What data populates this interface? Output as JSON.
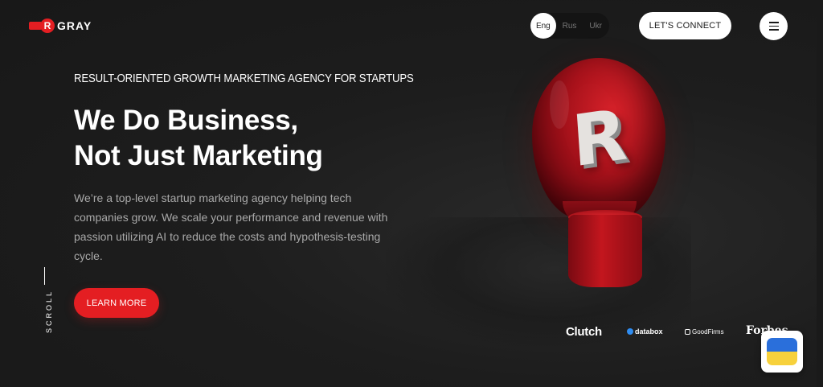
{
  "brand": {
    "mark_letter": "R",
    "name": "GRAY"
  },
  "header": {
    "languages": [
      {
        "label": "Eng",
        "active": true
      },
      {
        "label": "Rus",
        "active": false
      },
      {
        "label": "Ukr",
        "active": false
      }
    ],
    "connect_label": "LET'S CONNECT",
    "menu_icon": "hamburger-icon"
  },
  "hero": {
    "subheading": "RESULT-ORIENTED GROWTH MARKETING AGENCY FOR STARTUPS",
    "headline_line1": "We Do Business,",
    "headline_line2": "Not Just Marketing",
    "description": "We’re a top-level startup marketing agency helping tech companies grow. We scale your performance and revenue with passion utilizing AI to reduce the costs and hypothesis-testing cycle.",
    "cta_label": "LEARN MORE",
    "scroll_label": "SCROLL",
    "bulb_letter": "R"
  },
  "partners": {
    "clutch": "Clutch",
    "databox": "databox",
    "goodfirms": "GoodFirms",
    "forbes": "Forbes"
  },
  "colors": {
    "accent": "#e41e22",
    "background": "#1d1d1d",
    "ukraine_blue": "#2a6fdb",
    "ukraine_yellow": "#f7d13c"
  }
}
